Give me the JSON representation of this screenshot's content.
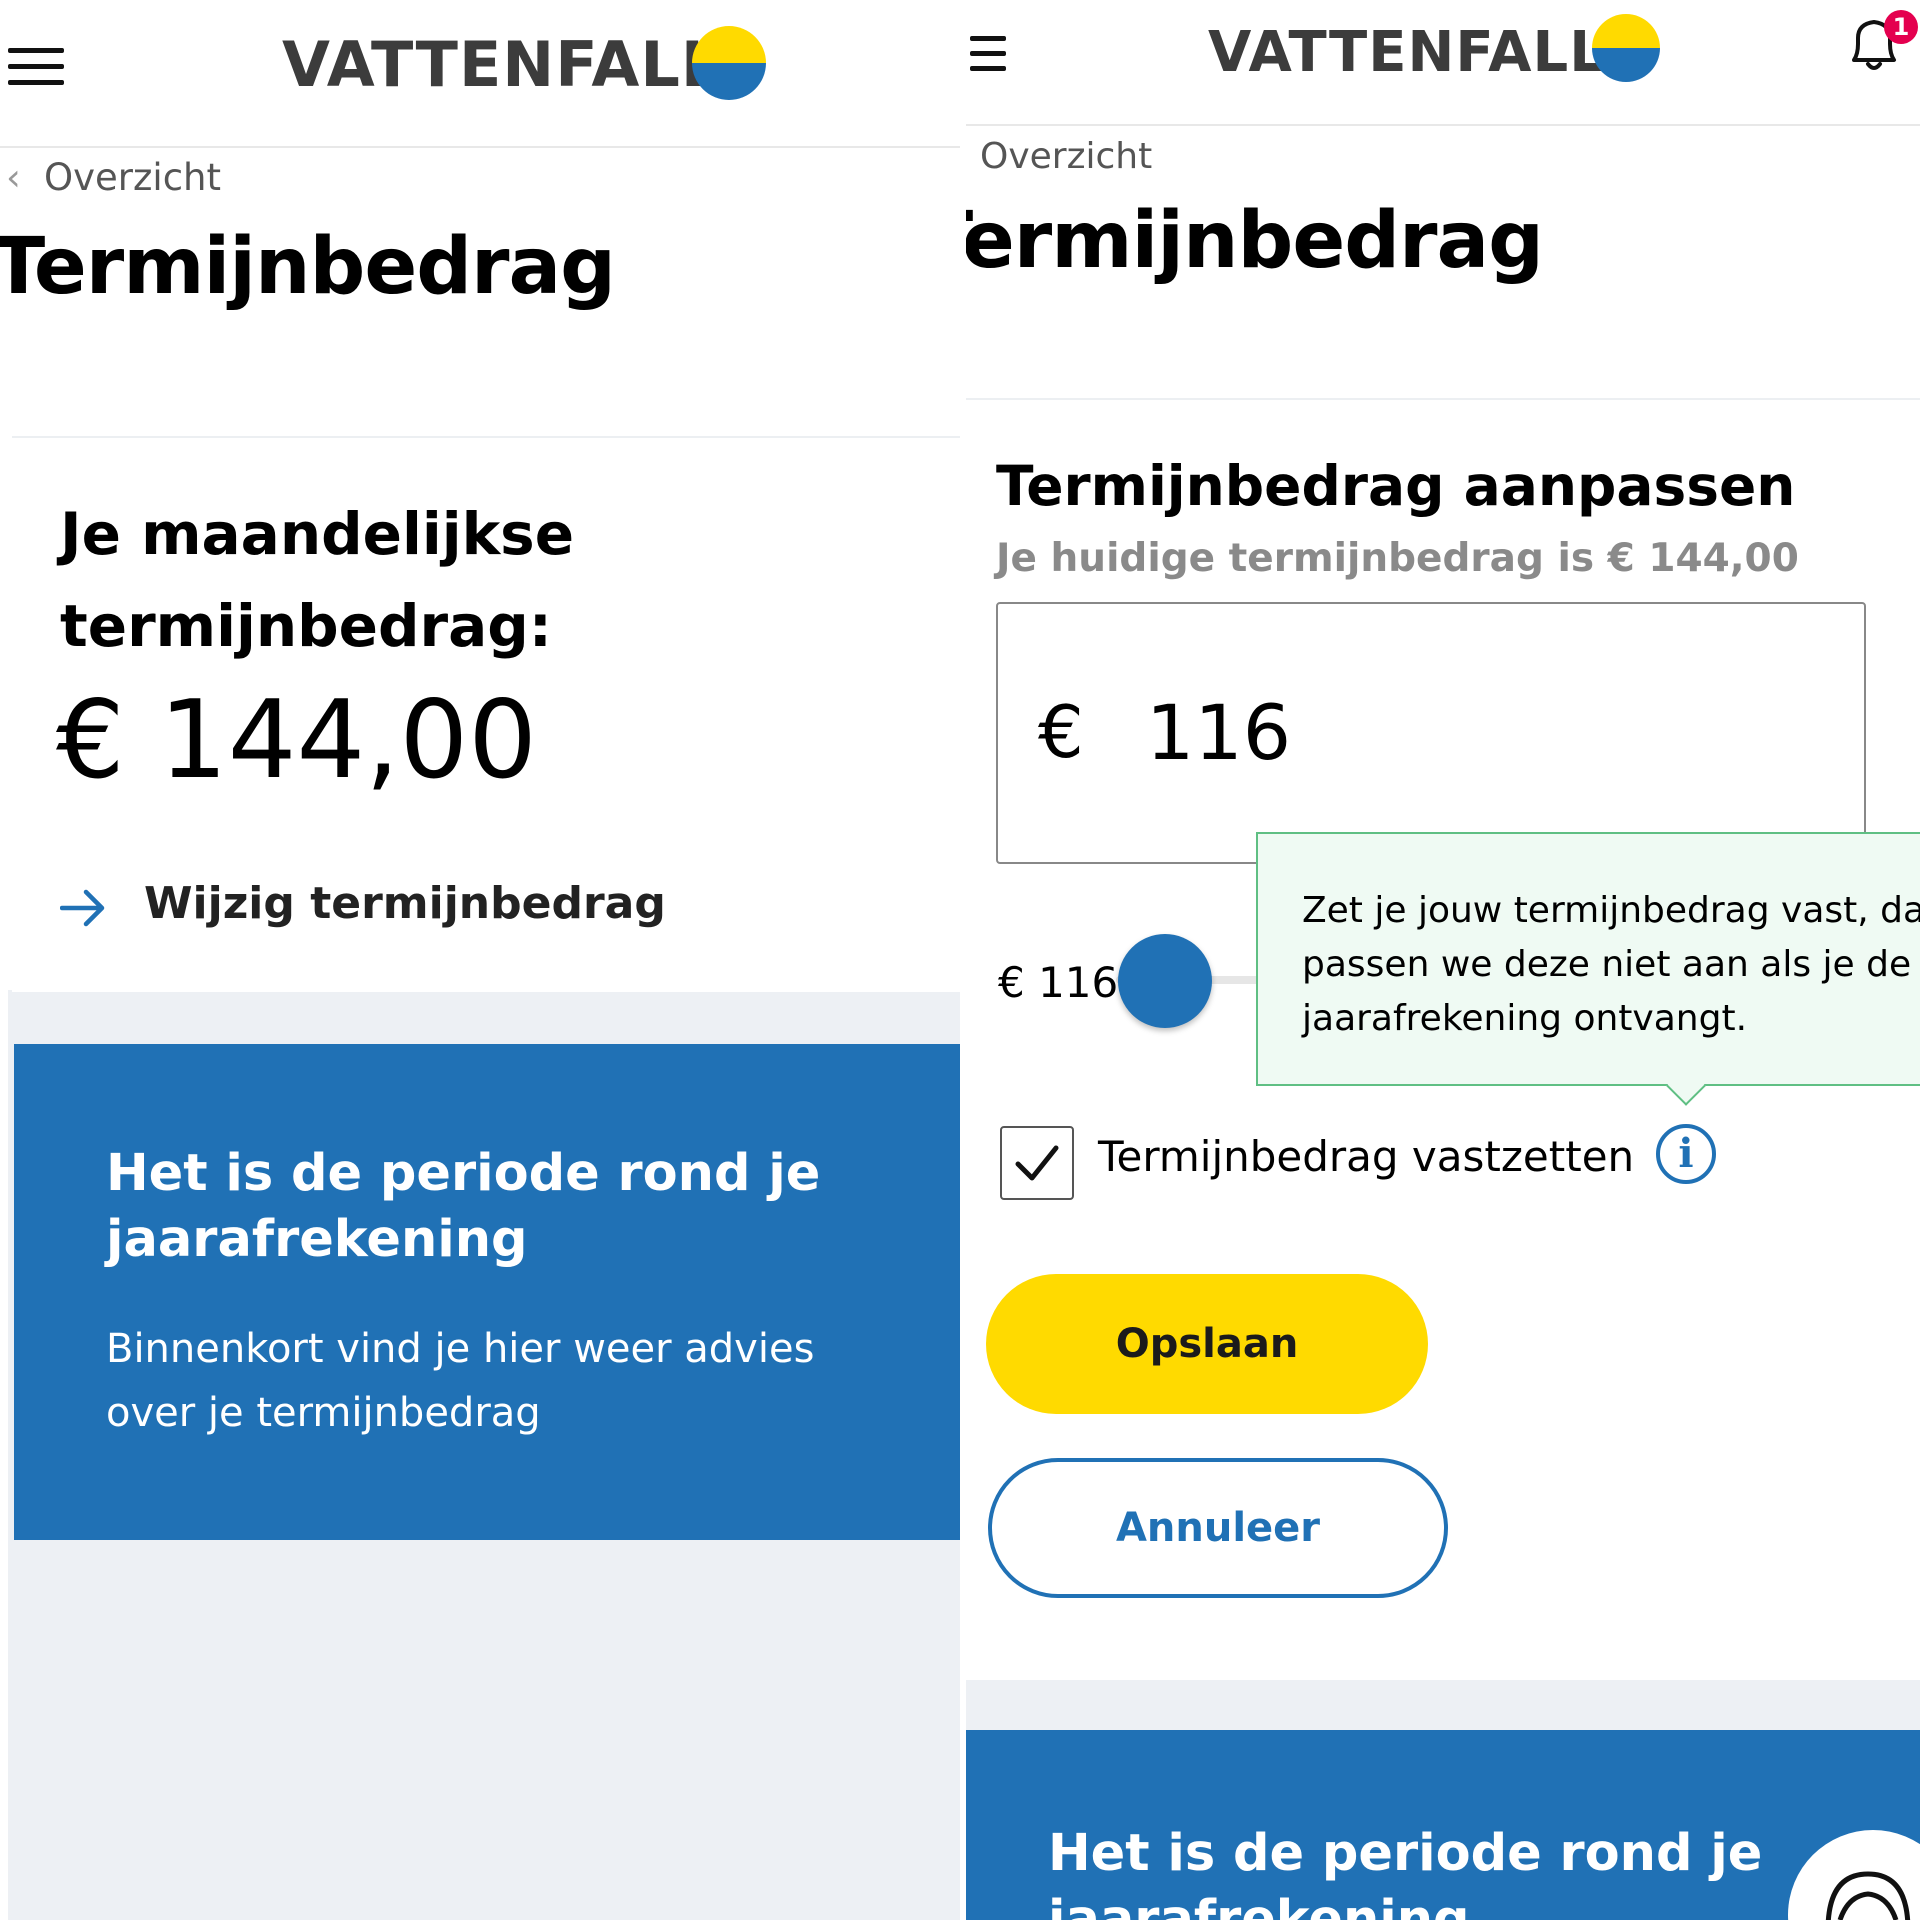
{
  "left": {
    "logo_text": "VATTENFALL",
    "breadcrumb": "Overzicht",
    "page_title": "Termijnbedrag",
    "card": {
      "heading_line1": "Je maandelijkse",
      "heading_line2": "termijnbedrag:",
      "amount": "€ 144,00",
      "link_label": "Wijzig termijnbedrag"
    },
    "notice": {
      "title_line1": "Het is de periode rond je",
      "title_line2": "jaarafrekening",
      "body_line1": "Binnenkort vind je hier weer advies",
      "body_line2": "over je termijnbedrag"
    }
  },
  "right": {
    "logo_text": "VATTENFALL",
    "notification_count": "1",
    "breadcrumb": "Overzicht",
    "page_title": "Termijnbedrag",
    "form": {
      "heading": "Termijnbedrag aanpassen",
      "subheading": "Je huidige termijnbedrag is € 144,00",
      "currency_symbol": "€",
      "amount_value": "116",
      "slider_label": "€ 116",
      "tooltip_line1": "Zet je jouw termijnbedrag vast, da",
      "tooltip_line2": "passen we deze niet aan als je de",
      "tooltip_line3": "jaarafrekening ontvangt.",
      "checkbox_label": "Termijnbedrag vastzetten",
      "checkbox_checked": true,
      "info_icon_glyph": "i",
      "save_label": "Opslaan",
      "cancel_label": "Annuleer"
    },
    "notice": {
      "title_line1": "Het is de periode rond je",
      "title_line2": "jaarafrekening"
    }
  },
  "colors": {
    "brand_blue": "#2071b5",
    "brand_yellow": "#ffda00",
    "tooltip_bg": "#effaf3",
    "tooltip_border": "#5fbf83",
    "badge_red": "#e4004f"
  }
}
